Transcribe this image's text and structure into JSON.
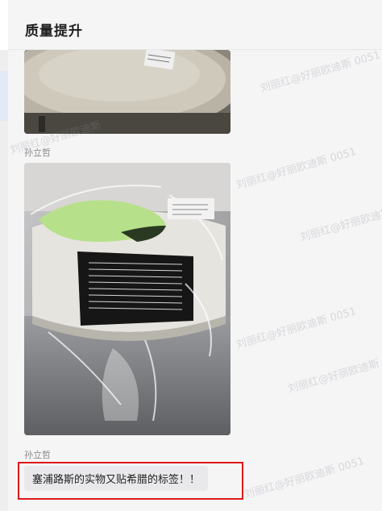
{
  "header": {
    "title": "质量提升"
  },
  "messages": [
    {
      "type": "image",
      "sender": "",
      "alt": "tape roll photo (partial)"
    },
    {
      "type": "image",
      "sender": "孙立哲",
      "alt": "wrapped tape roll photo"
    },
    {
      "type": "text",
      "sender": "孙立哲",
      "text": "塞浦路斯的实物又贴希腊的标签！！"
    }
  ],
  "watermark": {
    "text_a": "刘丽红@好丽欧迪斯 0051",
    "text_b": "刘丽红@好丽欧迪斯"
  },
  "colors": {
    "highlight": "#e01818",
    "bubble": "#e9e9eb"
  }
}
